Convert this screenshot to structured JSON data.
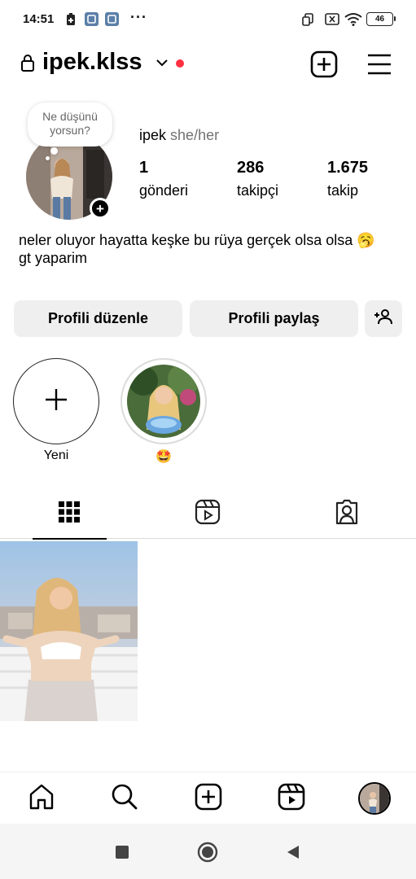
{
  "status_bar": {
    "time": "14:51",
    "battery": "46",
    "dots": "···"
  },
  "header": {
    "username": "ipek.klss",
    "notification_color": "#ff3040"
  },
  "profile": {
    "note_text": "Ne düşünü yorsun?",
    "name": "ipek",
    "pronouns": "she/her",
    "stats": [
      {
        "value": "1",
        "label": "gönderi"
      },
      {
        "value": "286",
        "label": "takipçi"
      },
      {
        "value": "1.675",
        "label": "takip"
      }
    ],
    "bio_lines": [
      "neler oluyor hayatta keşke bu rüya gerçek olsa olsa 🥱",
      "gt yaparim"
    ]
  },
  "buttons": {
    "edit_profile": "Profili düzenle",
    "share_profile": "Profili paylaş"
  },
  "highlights": {
    "new_label": "Yeni",
    "story_label": "🤩"
  },
  "tabs": [
    "grid-icon",
    "reels-icon",
    "tagged-icon"
  ],
  "bottom_nav": [
    "home-icon",
    "search-icon",
    "create-icon",
    "reels-icon",
    "profile-avatar"
  ],
  "system_nav": [
    "recents-icon",
    "home-icon",
    "back-icon"
  ]
}
